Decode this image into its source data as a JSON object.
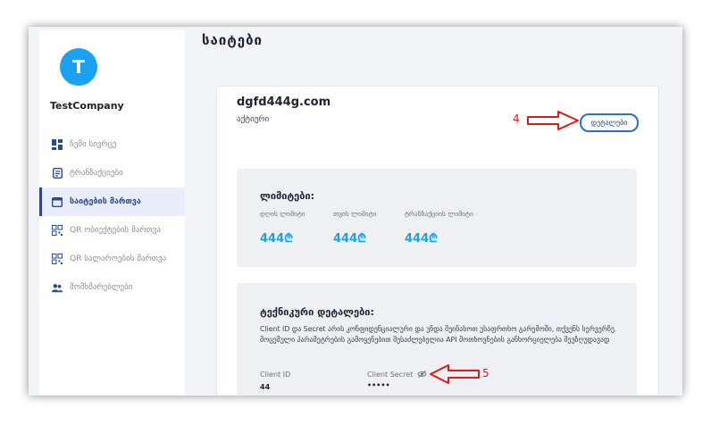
{
  "sidebar": {
    "avatar_letter": "T",
    "company": "TestCompany",
    "items": [
      {
        "label": "ჩემი სივრცე",
        "icon": "dashboard-icon"
      },
      {
        "label": "ტრანზაქციები",
        "icon": "document-icon"
      },
      {
        "label": "საიტების მართვა",
        "icon": "browser-window-icon"
      },
      {
        "label": "QR ობიექტების მართვა",
        "icon": "qr-code-icon"
      },
      {
        "label": "QR სალაროების მართვა",
        "icon": "qr-code-icon"
      },
      {
        "label": "მომხმარებლები",
        "icon": "users-icon"
      }
    ],
    "active_index": 2
  },
  "page": {
    "title": "საიტები"
  },
  "site": {
    "domain": "dgfd444g.com",
    "status": "აქტიური",
    "details_button": "დეტალები"
  },
  "limits": {
    "title": "ლიმიტები:",
    "items": [
      {
        "label": "დღის ლიმიტი",
        "value": "444",
        "currency": "₾"
      },
      {
        "label": "თვის ლიმიტი",
        "value": "444",
        "currency": "₾"
      },
      {
        "label": "ტრანზაქციის ლიმიტი",
        "value": "444",
        "currency": "₾"
      }
    ]
  },
  "technical": {
    "title": "ტექნიკური დეტალები:",
    "description": "Client ID და Secret არის კონფიდენციალური და უნდა შეინახოთ უსაფრთხო გარემოში, თქვენს სერვერზე. მოცემული პარამეტრების გამოყენებით შესაძლებელია API მოთხოვნების განხორციელება შეუზღუდავად",
    "client_id_label": "Client ID",
    "client_id_value": "44",
    "client_secret_label": "Client Secret",
    "client_secret_value": "•••••"
  },
  "annotations": {
    "arrow_details": "4",
    "arrow_secret": "5",
    "color": "#d91c1c"
  }
}
